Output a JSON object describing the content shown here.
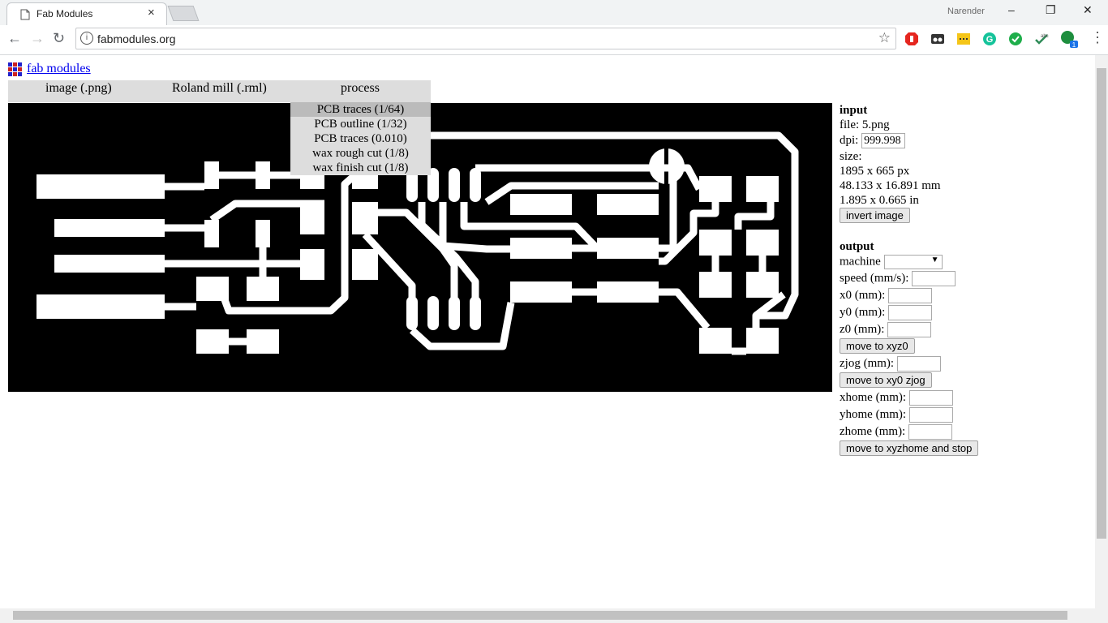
{
  "browser": {
    "tab_title": "Fab Modules",
    "tab_close": "×",
    "profile_name": "Narender",
    "url": "fabmodules.org"
  },
  "page": {
    "title_link": "fab modules",
    "menu": {
      "input": "image (.png)",
      "output": "Roland mill (.rml)",
      "process": "process"
    },
    "process_options": [
      "PCB traces (1/64)",
      "PCB outline (1/32)",
      "PCB traces (0.010)",
      "wax rough cut (1/8)",
      "wax finish cut (1/8)"
    ],
    "input_panel": {
      "heading": "input",
      "file_label": "file: 5.png",
      "dpi_label": "dpi:",
      "dpi_value": "999.998",
      "size_label": "size:",
      "size_px": "1895 x 665 px",
      "size_mm": "48.133 x 16.891 mm",
      "size_in": "1.895 x 0.665 in",
      "invert_button": "invert image"
    },
    "output_panel": {
      "heading": "output",
      "machine_label": "machine",
      "speed_label": "speed (mm/s):",
      "x0_label": "x0 (mm):",
      "y0_label": "y0 (mm):",
      "z0_label": "z0 (mm):",
      "move_xyz0_button": "move to xyz0",
      "zjog_label": "zjog (mm):",
      "move_xy0_zjog_button": "move to xy0 zjog",
      "xhome_label": "xhome (mm):",
      "yhome_label": "yhome (mm):",
      "zhome_label": "zhome (mm):",
      "move_home_button": "move to xyzhome and stop"
    }
  },
  "colors": {
    "link": "#0000ee",
    "menu_bg": "#dddddd",
    "menu_selected": "#bbbbbb",
    "board_bg": "#000000",
    "trace": "#ffffff"
  }
}
